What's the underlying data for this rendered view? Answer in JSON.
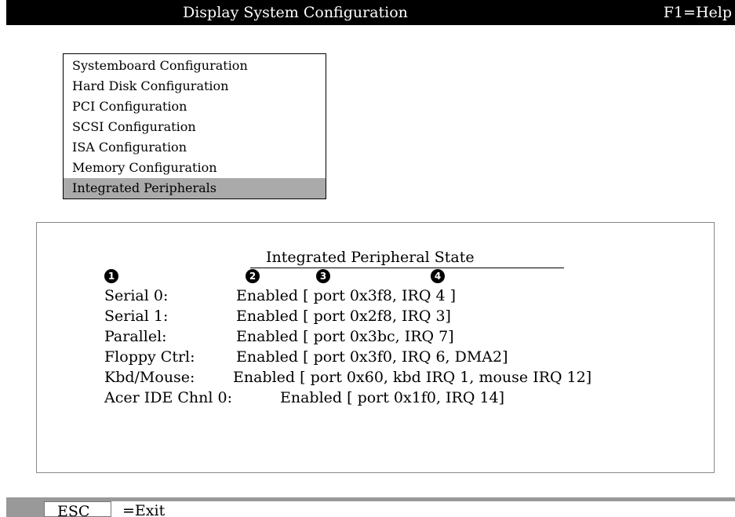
{
  "header": {
    "title": "Display System Configuration",
    "help": "F1=Help"
  },
  "menu": {
    "items": [
      {
        "label": "Systemboard Configuration"
      },
      {
        "label": "Hard Disk Configuration"
      },
      {
        "label": "PCI Configuration"
      },
      {
        "label": "SCSI Configuration"
      },
      {
        "label": "ISA Configuration"
      },
      {
        "label": "Memory Configuration"
      },
      {
        "label": "Integrated Peripherals"
      }
    ],
    "selected": "Integrated Peripherals"
  },
  "panel": {
    "title": "Integrated Peripheral State",
    "callouts": [
      "1",
      "2",
      "3",
      "4"
    ],
    "rows": [
      {
        "device": "Serial 0:",
        "state": "Enabled [ port 0x3f8, IRQ 4 ]"
      },
      {
        "device": "Serial 1:",
        "state": "Enabled [ port 0x2f8, IRQ 3]"
      },
      {
        "device": "Parallel:",
        "state": "Enabled [ port 0x3bc, IRQ 7]"
      },
      {
        "device": "Floppy Ctrl:",
        "state": "Enabled [ port 0x3f0, IRQ 6, DMA2]"
      },
      {
        "device": "Kbd/Mouse:",
        "state": "Enabled [ port 0x60, kbd IRQ 1, mouse IRQ 12]"
      },
      {
        "device": "Acer IDE Chnl 0:",
        "state": "Enabled [ port 0x1f0, IRQ 14]"
      }
    ]
  },
  "footer": {
    "key": "ESC",
    "action": "=Exit"
  },
  "colors": {
    "title_bar": "#000000",
    "selection": "#aaaaaa",
    "status_bar": "#999999"
  }
}
